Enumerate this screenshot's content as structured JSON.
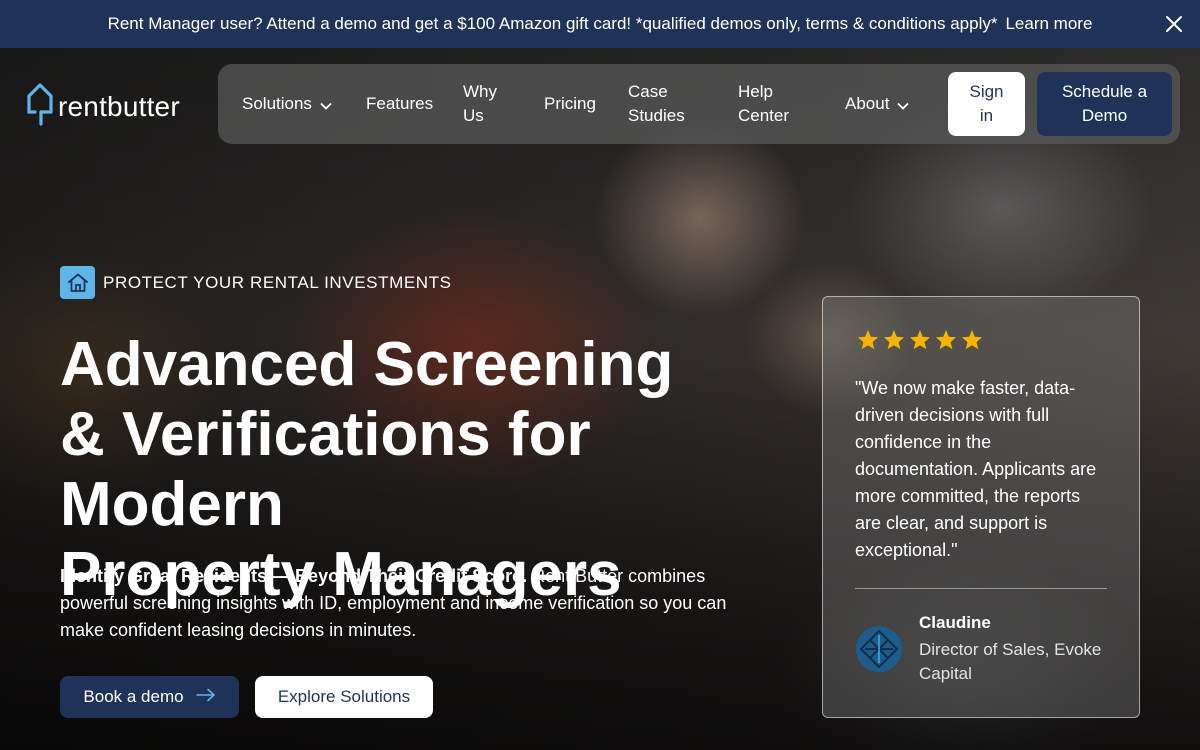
{
  "announcement": {
    "text": "Rent Manager user? Attend a demo and get a $100 Amazon gift card! *qualified demos only, terms & conditions apply*",
    "link": "Learn more",
    "close_icon": "close-icon"
  },
  "brand": {
    "name": "rentbutter",
    "colors": {
      "navy": "#1f3358",
      "accent": "#5fb4e8",
      "star": "#f5b400"
    }
  },
  "nav": {
    "items": [
      {
        "label": "Solutions",
        "dropdown": true
      },
      {
        "label": "Features",
        "dropdown": false
      },
      {
        "label": "Why Us",
        "dropdown": false
      },
      {
        "label": "Pricing",
        "dropdown": false
      },
      {
        "label": "Case Studies",
        "dropdown": false
      },
      {
        "label": "Help Center",
        "dropdown": false
      },
      {
        "label": "About",
        "dropdown": true
      }
    ],
    "sign_in": "Sign in",
    "schedule_demo": "Schedule a Demo"
  },
  "hero": {
    "eyebrow_icon": "home-icon",
    "eyebrow": "PROTECT YOUR RENTAL INVESTMENTS",
    "headline_line1": "Advanced Screening",
    "headline_line2": "& Verifications for Modern",
    "headline_line3": "Property Managers",
    "description_bold": "Identify Great Residents — Beyond Their Credit Score.",
    "description": " Rent Butter combines powerful screening insights with ID, employment and income verification so you can make confident leasing decisions in minutes.",
    "book_demo": "Book a demo",
    "explore": "Explore Solutions"
  },
  "testimonial": {
    "rating": 5,
    "quote": "\"We now make faster, data-driven decisions with full confidence in the documentation. Applicants are more committed, the reports are clear, and support is exceptional.\"",
    "name": "Claudine",
    "role": "Director of Sales, Evoke Capital"
  }
}
